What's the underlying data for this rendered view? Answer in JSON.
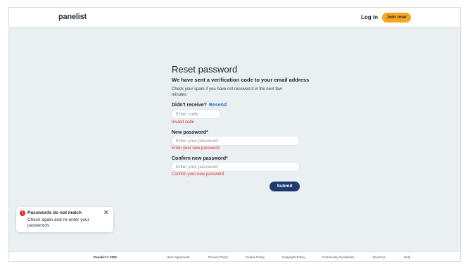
{
  "header": {
    "logo": "panelist",
    "login_label": "Log in",
    "join_label": "Join now"
  },
  "form": {
    "title": "Reset password",
    "subtitle": "We have sent a verification code to your email address",
    "hint": "Check your spam if you have not received it in the next few minutes",
    "didnt_receive": "Didn't receive?",
    "resend_label": "Resend",
    "code_placeholder": "Enter code",
    "code_error": "Invalid code",
    "new_password_label": "New password*",
    "new_password_placeholder": "Enter your password",
    "new_password_error": "Enter your new password",
    "confirm_password_label": "Confirm new password*",
    "confirm_password_placeholder": "Enter your password",
    "confirm_password_error": "Confirm your new password",
    "submit_label": "Submit"
  },
  "toast": {
    "icon": "error-icon",
    "title": "Passwords do not match",
    "body": "Check again and re-enter your passwords",
    "close_icon": "close-icon"
  },
  "footer": {
    "copyright": "Panelist © 2021",
    "links": [
      "User Agreement",
      "Privacy Policy",
      "Cookie Policy",
      "Copyright Policy",
      "Community Guidelines",
      "About Us",
      "Help"
    ]
  },
  "colors": {
    "accent": "#f6a623",
    "primary": "#1e3a6e",
    "error": "#d93025",
    "link": "#2f6fc9",
    "background": "#eaeff2"
  }
}
